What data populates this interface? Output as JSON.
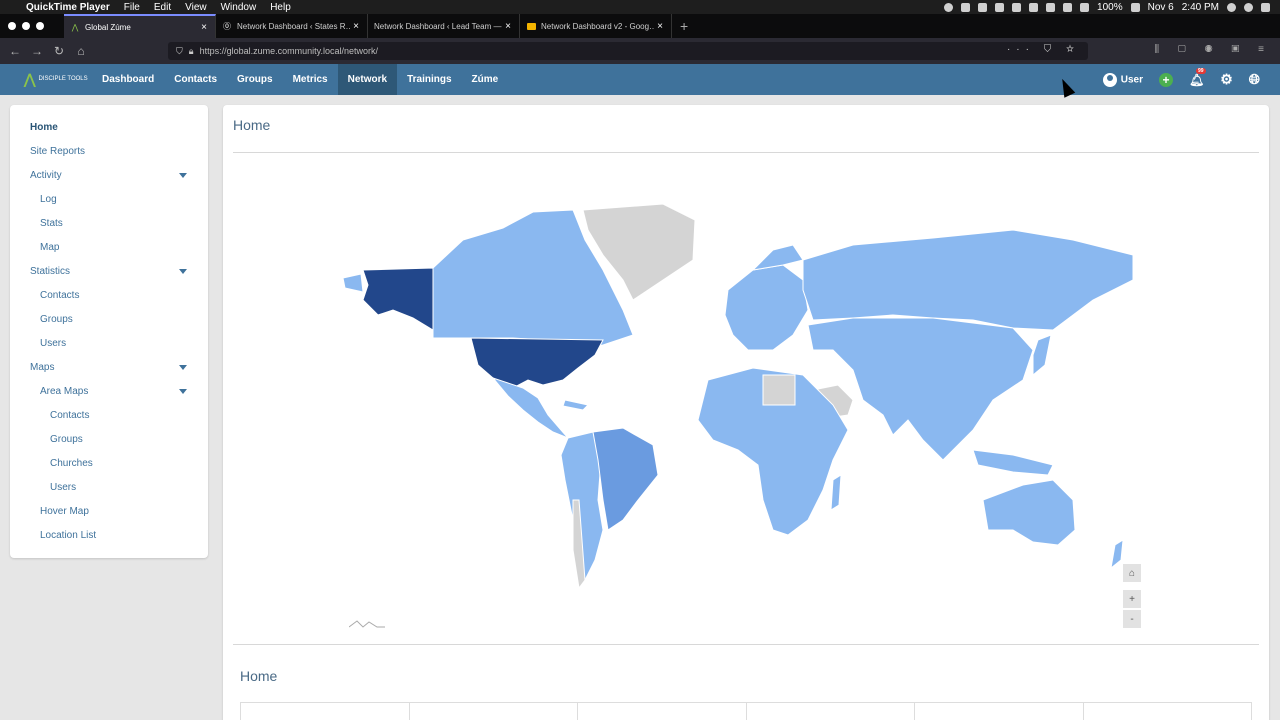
{
  "mac_menu": {
    "app": "QuickTime Player",
    "items": [
      "File",
      "Edit",
      "View",
      "Window",
      "Help"
    ],
    "battery": "100%",
    "date": "Nov 6",
    "time": "2:40 PM"
  },
  "tabs": [
    {
      "title": "Global Zúme",
      "active": true
    },
    {
      "title": "Network Dashboard ‹ States R…",
      "active": false
    },
    {
      "title": "Network Dashboard ‹ Lead Team —",
      "active": false
    },
    {
      "title": "Network Dashboard v2 - Goog…",
      "active": false
    }
  ],
  "url": "https://global.zume.community.local/network/",
  "appnav": {
    "logo_text": "DISCIPLE TOOLS",
    "links": [
      "Dashboard",
      "Contacts",
      "Groups",
      "Metrics",
      "Network",
      "Trainings",
      "Zúme"
    ],
    "active": "Network",
    "user_label": "User",
    "notification_count": "99"
  },
  "sidebar": {
    "items": [
      {
        "label": "Home",
        "bold": true
      },
      {
        "label": "Site Reports"
      },
      {
        "label": "Activity"
      },
      {
        "label": "Log"
      },
      {
        "label": "Stats"
      },
      {
        "label": "Map"
      },
      {
        "label": "Statistics"
      },
      {
        "label": "Contacts"
      },
      {
        "label": "Groups"
      },
      {
        "label": "Users"
      },
      {
        "label": "Maps"
      },
      {
        "label": "Area Maps"
      },
      {
        "label": "Contacts"
      },
      {
        "label": "Groups"
      },
      {
        "label": "Churches"
      },
      {
        "label": "Users"
      },
      {
        "label": "Hover Map"
      },
      {
        "label": "Location List"
      }
    ]
  },
  "main": {
    "title": "Home",
    "section_title": "Home",
    "map_controls": {
      "home": "⌂",
      "zoom_in": "+",
      "zoom_out": "-"
    }
  },
  "colors": {
    "nav_bg": "#3f729b",
    "map_dark": "#22478b",
    "map_mid": "#6a9be0",
    "map_light": "#8ab8f0",
    "map_no_data": "#d4d4d4"
  }
}
